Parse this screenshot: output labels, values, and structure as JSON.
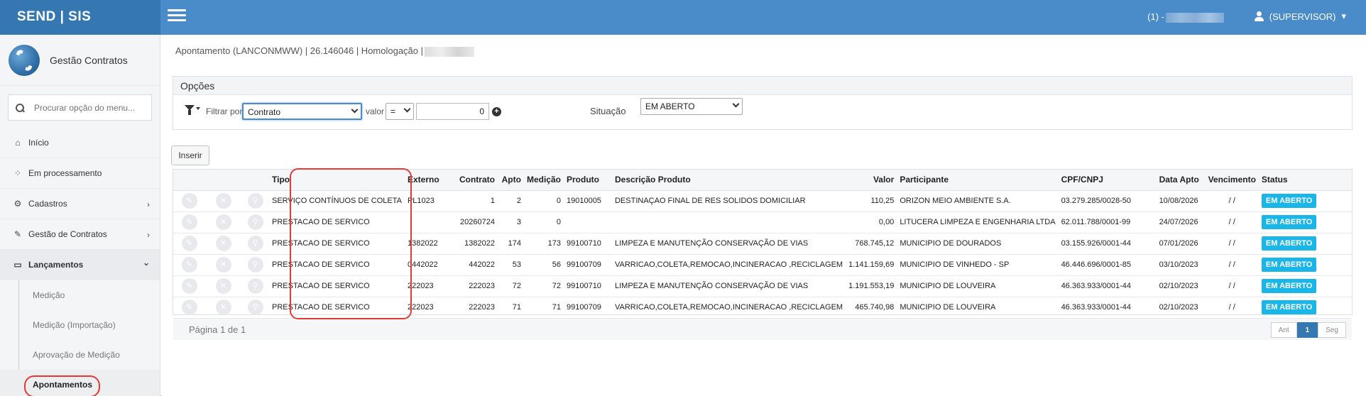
{
  "brand": "SEND | SIS",
  "top": {
    "user_id_prefix": "(1) -",
    "user_label": "(SUPERVISOR)",
    "caret": "▾"
  },
  "sidebar": {
    "app_title": "Gestão Contratos",
    "search_placeholder": "Procurar opção do menu...",
    "items": [
      {
        "label": "Início",
        "icon": "home-icon",
        "glyph": "⌂"
      },
      {
        "label": "Em processamento",
        "icon": "spinner-icon",
        "glyph": "⁘"
      },
      {
        "label": "Cadastros",
        "icon": "gears-icon",
        "glyph": "⚙",
        "chevron": "›"
      },
      {
        "label": "Gestão de Contratos",
        "icon": "edit-icon",
        "glyph": "✎",
        "chevron": "›"
      },
      {
        "label": "Lançamentos",
        "icon": "laptop-icon",
        "glyph": "▭",
        "chevron": "⌄"
      }
    ],
    "sub_items": [
      "Medição",
      "Medição (Importação)",
      "Aprovação de Medição",
      "Apontamentos"
    ]
  },
  "breadcrumb": "Apontamento (LANCONMWW) | 26.146046 | Homologação |",
  "options": {
    "title": "Opções",
    "filter_label": "Filtrar por",
    "filter_value": "Contrato",
    "valor_label": "valor",
    "operator": "=",
    "value": "0",
    "plus": "+",
    "situacao_label": "Situação",
    "situacao_value": "EM ABERTO"
  },
  "insert_label": "Inserir",
  "table": {
    "headers": [
      "Tipo",
      "Externo",
      "Contrato",
      "Apto",
      "Medição",
      "Produto",
      "Descrição Produto",
      "Valor",
      "Participante",
      "CPF/CNPJ",
      "Data Apto",
      "Vencimento",
      "Status"
    ],
    "rows": [
      [
        "SERVIÇO CONTÍNUOS DE COLETA",
        "PL1023",
        "1",
        "2",
        "0",
        "19010005",
        "DESTINAÇAO FINAL DE RES SOLIDOS DOMICILIAR",
        "110,25",
        "ORIZON MEIO AMBIENTE S.A.",
        "03.279.285/0028-50",
        "10/08/2026",
        "/ /",
        "EM ABERTO"
      ],
      [
        "PRESTACAO DE SERVICO",
        "",
        "20260724",
        "3",
        "0",
        "",
        "",
        "0,00",
        "LITUCERA LIMPEZA E ENGENHARIA LTDA",
        "62.011.788/0001-99",
        "24/07/2026",
        "/ /",
        "EM ABERTO"
      ],
      [
        "PRESTACAO DE SERVICO",
        "1382022",
        "1382022",
        "174",
        "173",
        "99100710",
        "LIMPEZA E MANUTENÇÃO CONSERVAÇÃO DE VIAS",
        "768.745,12",
        "MUNICIPIO DE DOURADOS",
        "03.155.926/0001-44",
        "07/01/2026",
        "/ /",
        "EM ABERTO"
      ],
      [
        "PRESTACAO DE SERVICO",
        "0442022",
        "442022",
        "53",
        "56",
        "99100709",
        "VARRICAO,COLETA,REMOCAO,INCINERACAO ,RECICLAGEM",
        "1.141.159,69",
        "MUNICIPIO DE VINHEDO - SP",
        "46.446.696/0001-85",
        "03/10/2023",
        "/ /",
        "EM ABERTO"
      ],
      [
        "PRESTACAO DE SERVICO",
        "222023",
        "222023",
        "72",
        "72",
        "99100710",
        "LIMPEZA E MANUTENÇÃO CONSERVAÇÃO DE VIAS",
        "1.191.553,19",
        "MUNICIPIO DE LOUVEIRA",
        "46.363.933/0001-44",
        "02/10/2023",
        "/ /",
        "EM ABERTO"
      ],
      [
        "PRESTACAO DE SERVICO",
        "222023",
        "222023",
        "71",
        "71",
        "99100709",
        "VARRICAO,COLETA,REMOCAO,INCINERACAO ,RECICLAGEM",
        "465.740,98",
        "MUNICIPIO DE LOUVEIRA",
        "46.363.933/0001-44",
        "02/10/2023",
        "/ /",
        "EM ABERTO"
      ]
    ],
    "row_actions": {
      "edit": "✎",
      "delete": "✕",
      "view": "⚲"
    }
  },
  "pager": {
    "text": "Página 1 de 1",
    "prev": "Ant",
    "current": "1",
    "next": "Seg"
  },
  "colors": {
    "brand": "#3577b1",
    "topbar": "#4a8cc9",
    "badge": "#1bb6e8",
    "highlight": "#e53935"
  }
}
